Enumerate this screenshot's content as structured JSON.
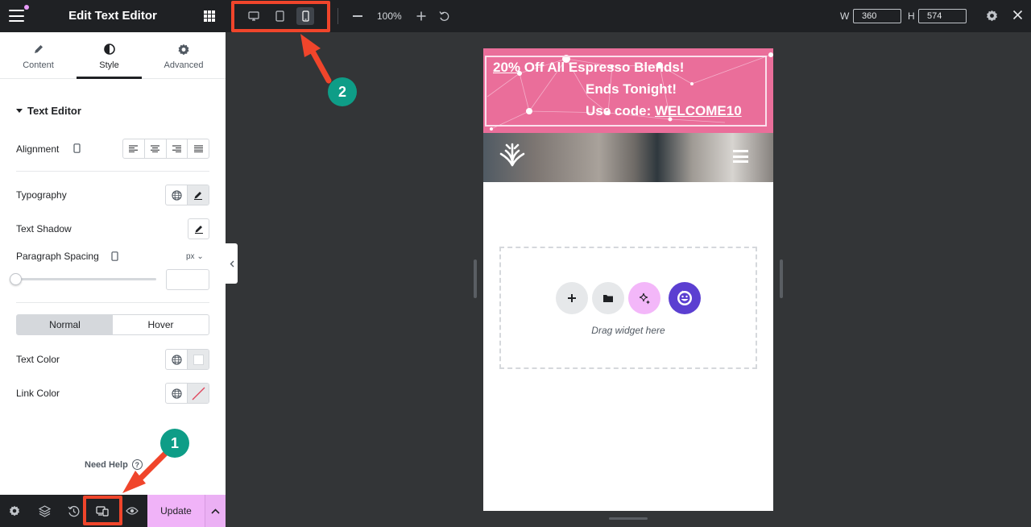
{
  "panel": {
    "title": "Edit Text Editor",
    "tabs": [
      {
        "label": "Content",
        "icon": "pencil-icon"
      },
      {
        "label": "Style",
        "icon": "half-circle-icon"
      },
      {
        "label": "Advanced",
        "icon": "gear-icon"
      }
    ],
    "active_tab": "Style",
    "section_title": "Text Editor",
    "controls": {
      "alignment": "Alignment",
      "typography": "Typography",
      "text_shadow": "Text Shadow",
      "paragraph_spacing": "Paragraph Spacing",
      "unit": "px",
      "paragraph_spacing_value": "",
      "state_normal": "Normal",
      "state_hover": "Hover",
      "active_state": "Normal",
      "text_color": "Text Color",
      "link_color": "Link Color"
    },
    "need_help": "Need Help",
    "footer": {
      "update_label": "Update",
      "icons": [
        "settings-icon",
        "layers-icon",
        "history-icon",
        "responsive-mode-icon",
        "preview-icon"
      ]
    }
  },
  "topbar": {
    "zoom": "100%",
    "width_label": "W",
    "width_value": "360",
    "height_label": "H",
    "height_value": "574",
    "active_device": "mobile"
  },
  "preview": {
    "promo_line1_underlined": "20%",
    "promo_line1_rest": " Off All Espresso Blends!",
    "promo_line2": "Ends Tonight!",
    "promo_line3_prefix": "Use code: ",
    "promo_code": "WELCOME10",
    "drop_text": "Drag widget here"
  },
  "annotations": {
    "badge_1": "1",
    "badge_2": "2"
  },
  "colors": {
    "panel_dark": "#1f2124",
    "canvas_bg": "#333537",
    "update_button": "#f0b3f8",
    "promo_bg": "#ea6e9a",
    "annotation_red": "#f0452b",
    "badge_green": "#0e9d87",
    "ai_button": "#f3b7f9",
    "emoji_button": "#5b3fd1"
  }
}
